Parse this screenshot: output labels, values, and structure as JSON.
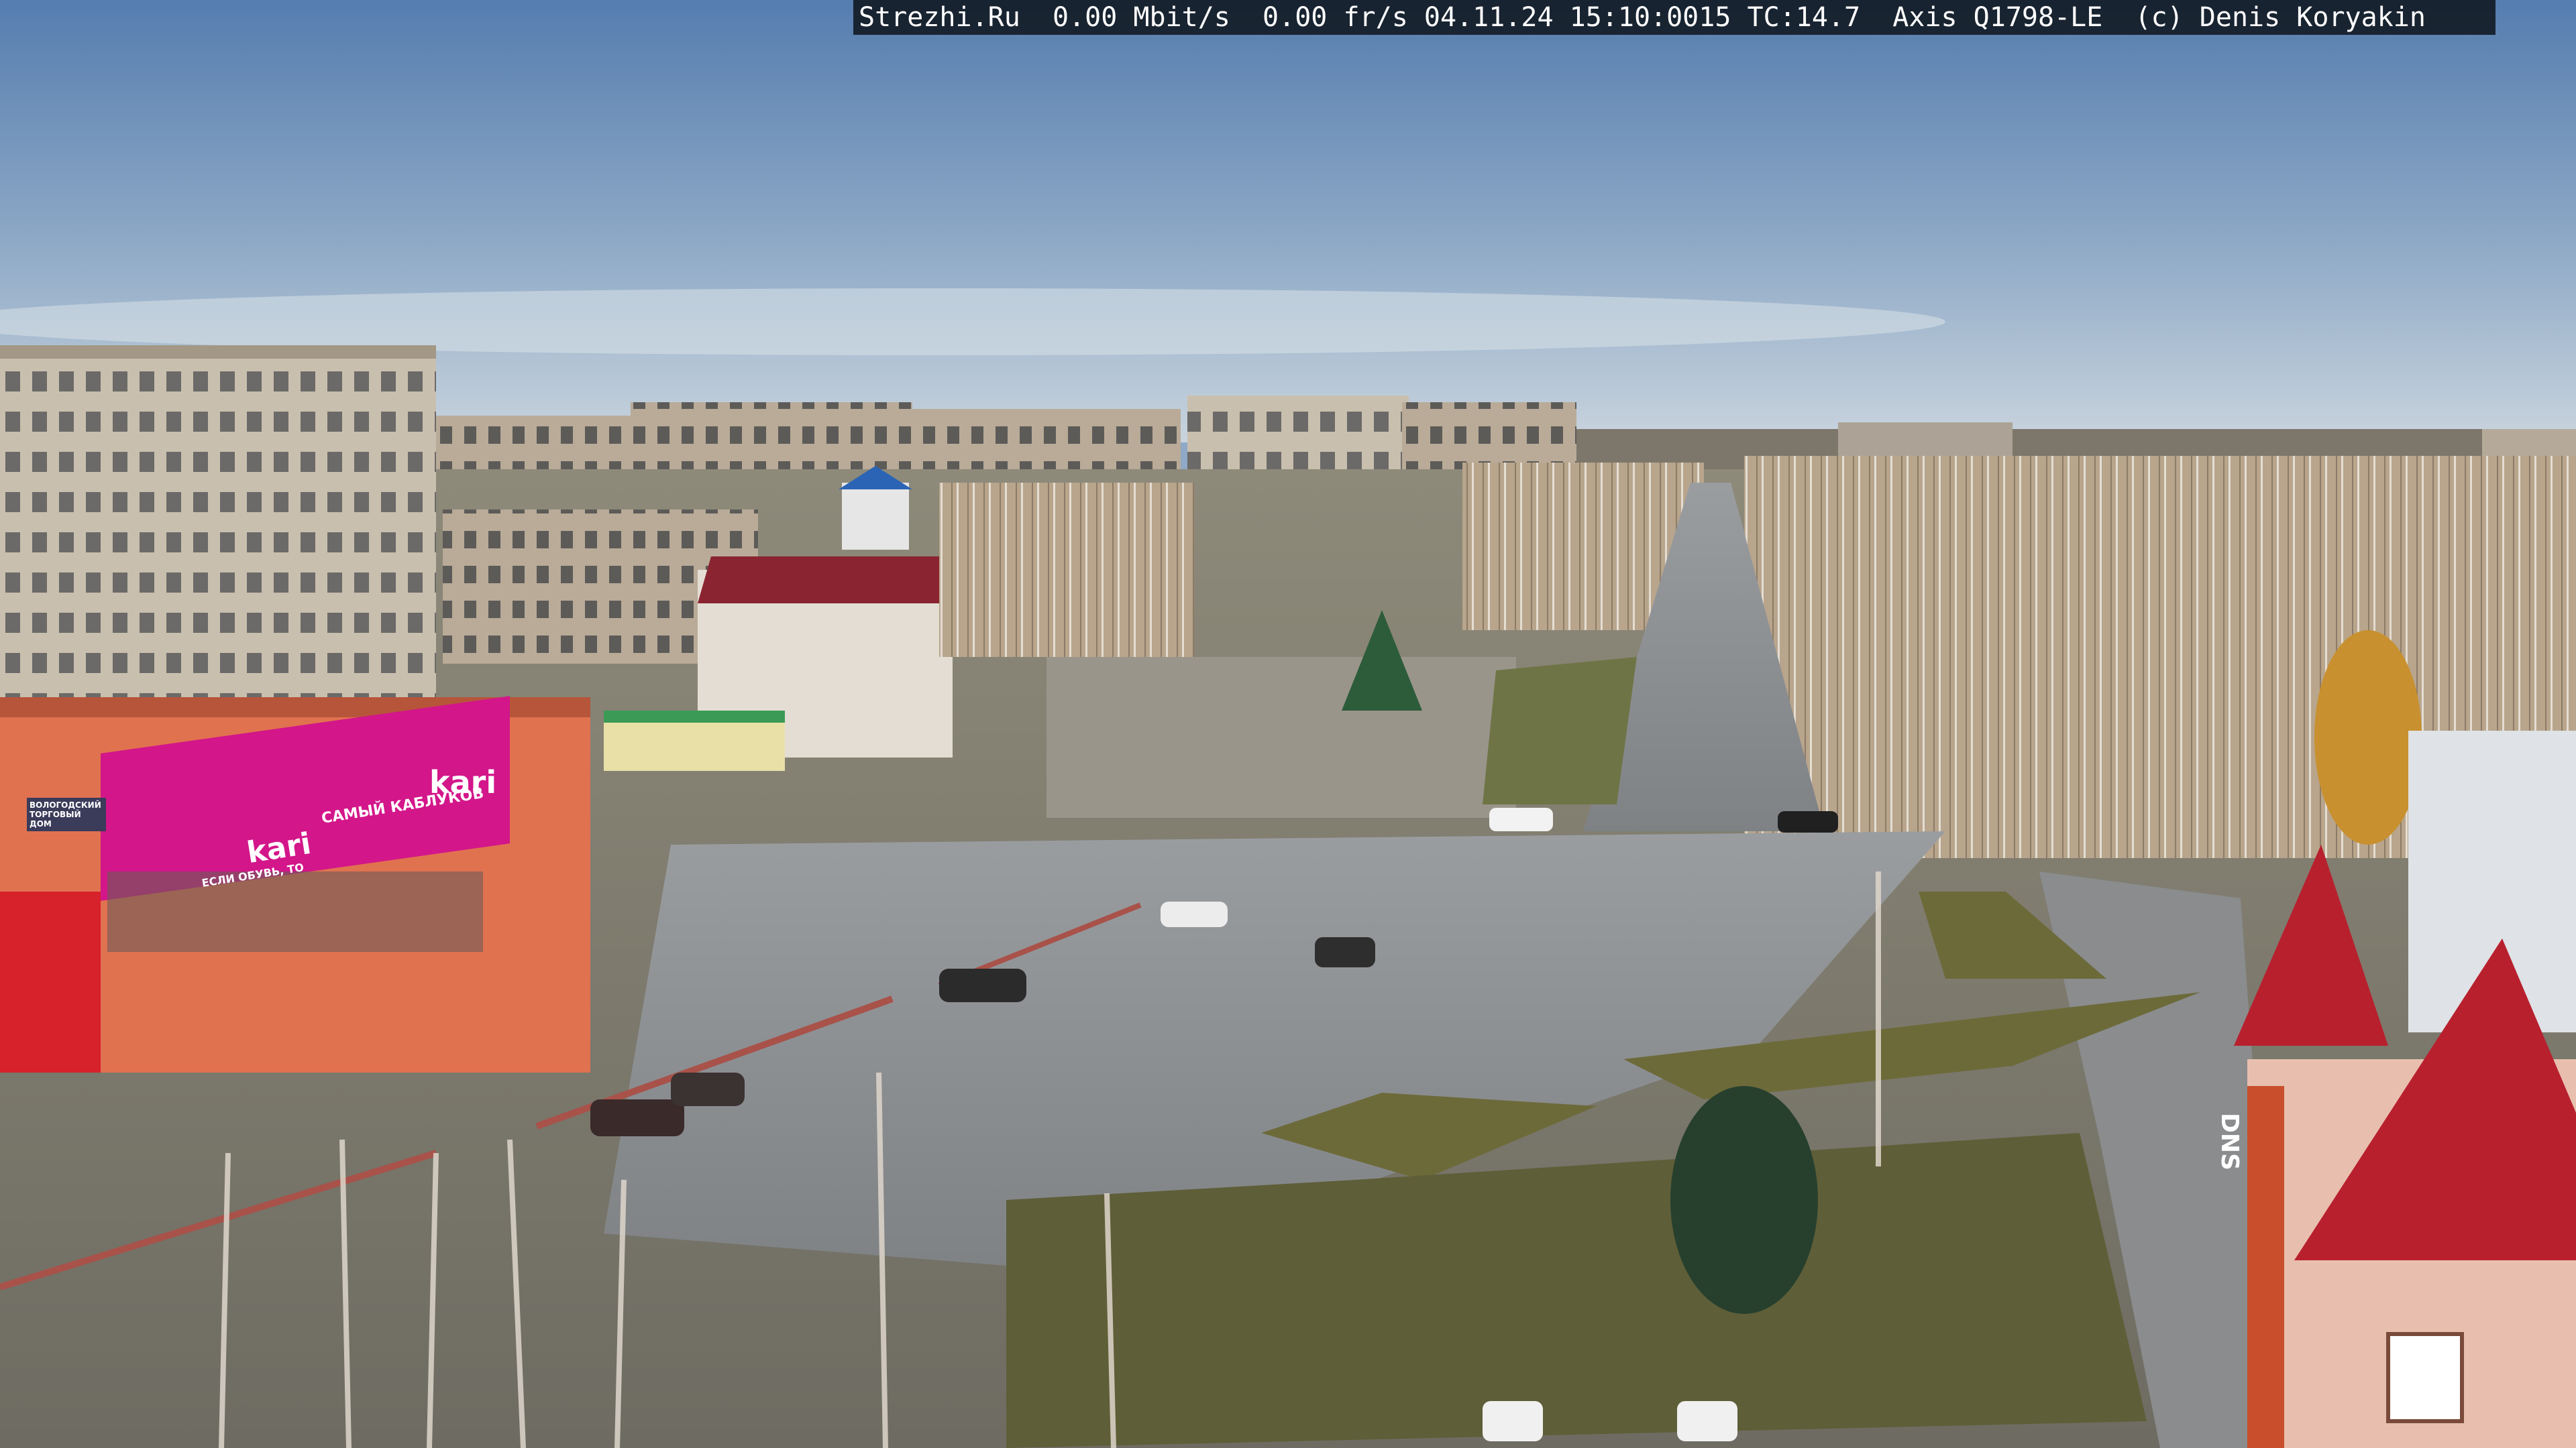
{
  "overlay": {
    "text": "Strezhi.Ru  0.00 Mbit/s  0.00 fr/s 04.11.24 15:10:0015 TC:14.7  Axis Q1798-LE  (c) Denis Koryakin"
  },
  "signs": {
    "store_main": "kari",
    "store_roof": "kari",
    "store_slogan": "САМЫЙ КАБЛУКОВ",
    "store_small": "ЕСЛИ ОБУВЬ, ТО",
    "left_banner": "ВОЛОГОДСКИЙ ТОРГОВЫЙ ДОМ",
    "right_tower": "DNS"
  },
  "colors": {
    "sky_top": "#5f86b5",
    "sky_bottom": "#c7d3df",
    "road": "#8c8f93",
    "grass": "#6d6a3a",
    "kari_magenta": "#d3168a",
    "roof_red": "#b8202e"
  }
}
